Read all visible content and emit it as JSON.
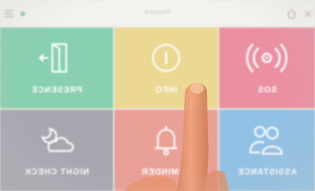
{
  "app": {
    "title": "Presence"
  },
  "tiles": [
    {
      "id": "presence",
      "label": "PRESENCE",
      "color": "#85d1ae",
      "icon": "door-exit-icon"
    },
    {
      "id": "info",
      "label": "INFO",
      "color": "#ecd88f",
      "icon": "info-icon"
    },
    {
      "id": "sos",
      "label": "SOS",
      "color": "#ee8fa1",
      "icon": "alarm-icon"
    },
    {
      "id": "night-check",
      "label": "NIGHT CHECK",
      "color": "#a8a7b0",
      "icon": "cloud-moon-icon"
    },
    {
      "id": "reminder",
      "label": "REMINDER",
      "color": "#ec9f95",
      "icon": "bell-icon"
    },
    {
      "id": "assistance",
      "label": "ASSISTANCE",
      "color": "#8fc1e6",
      "icon": "people-icon"
    }
  ],
  "titlebar_icons": [
    "menu-icon",
    "status-dot-icon",
    "home-icon",
    "close-icon"
  ]
}
